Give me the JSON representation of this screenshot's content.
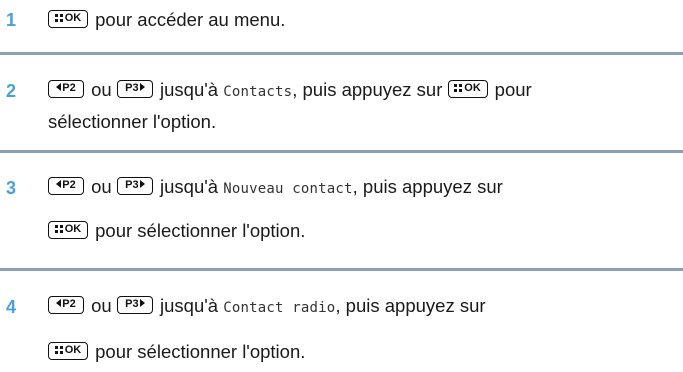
{
  "colors": {
    "step_number": "#4aa0d8",
    "divider": "#8aa0b4",
    "text": "#1a1a1a"
  },
  "keys": {
    "ok": "OK",
    "left": "P2",
    "right": "P3"
  },
  "step1": {
    "number": "1",
    "text": "pour accéder au menu."
  },
  "step2": {
    "number": "2",
    "or": "ou",
    "until": "jusqu'à",
    "item": "Contacts",
    "then_press": ", puis appuyez sur",
    "tail": "pour",
    "line2": "sélectionner l'option."
  },
  "step3": {
    "number": "3",
    "or": "ou",
    "until": "jusqu'à",
    "item": "Nouveau contact",
    "then_press": ", puis appuyez sur",
    "line2": "pour sélectionner l'option."
  },
  "step4": {
    "number": "4",
    "or": "ou",
    "until": "jusqu'à",
    "item": "Contact radio",
    "then_press": ", puis appuyez sur",
    "line2": "pour sélectionner l'option."
  }
}
